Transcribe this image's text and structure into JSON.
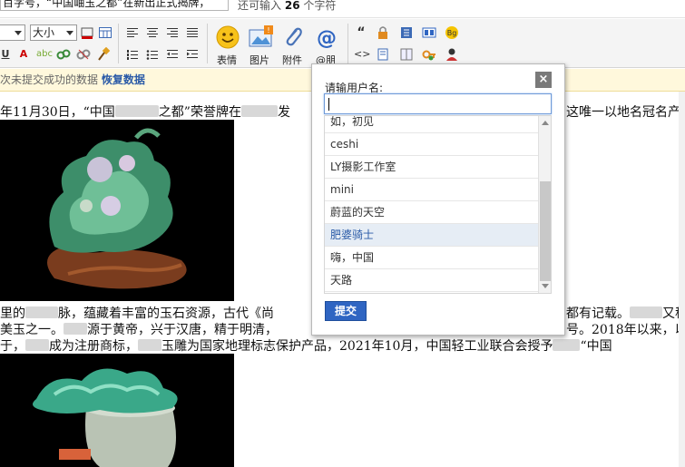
{
  "topbar": {
    "subject_value": "百字号，“中国岫玉之都”在新出正式揭牌，",
    "hint_prefix": "还可输入",
    "hint_count": "26",
    "hint_suffix": "个字符"
  },
  "toolbar": {
    "fontsize_label": "大小",
    "emoji_label": "表情",
    "image_label": "图片",
    "attach_label": "附件",
    "at_label": "@朋"
  },
  "restore": {
    "text": "次未提交成功的数据",
    "link": "恢复数据"
  },
  "article": {
    "line1a": "年11月30日，“中国",
    "line1b": "之都”荣誉牌在",
    "line1c": "发",
    "line1d": "这唯一以地名冠名产",
    "line2a": "里的",
    "line2b": "脉，蕴藏着丰富的玉石资源，古代《尚",
    "line2c": "都有记载。",
    "line2d": "又称",
    "line3a": "美玉之一。",
    "line3b": "源于黄帝，兴于汉唐，精于明清，",
    "line3c": "号。2018年以来，以",
    "line4a": "于，",
    "line4b": "成为注册商标，",
    "line4c": "玉雕为国家地理标志保护产品，2021年10月，中国轻工业联合会授予",
    "line4d": "“中国"
  },
  "popup": {
    "title": "请输用户名:",
    "input_value": "",
    "close": "×",
    "submit": "提交",
    "users": [
      "如，初见",
      "ceshi",
      "LY摄影工作室",
      "mini",
      "蔚蓝的天空",
      "肥婆骑士",
      "嗨，中国",
      "天路"
    ],
    "active_index": 5
  },
  "colors": {
    "accent": "#2f65c2",
    "link": "#2a5aa7",
    "restore_bg": "#fff8dc"
  }
}
